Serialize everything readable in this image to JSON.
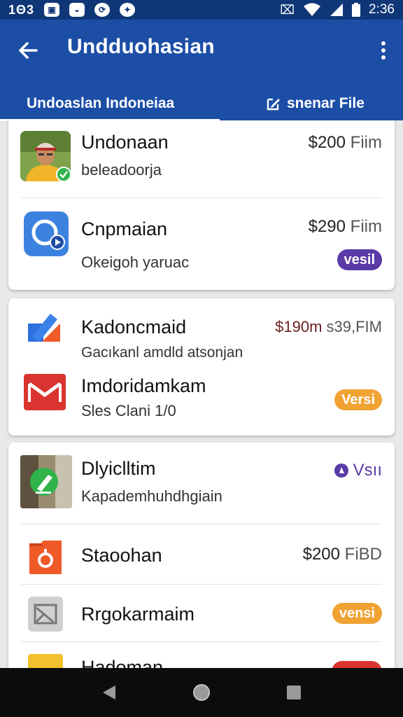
{
  "status_bar": {
    "left_time": "1Θ3",
    "right_time": "2:36",
    "icons": [
      "image-icon",
      "bag-icon",
      "sync-icon",
      "location-icon",
      "vibrate-icon",
      "wifi-icon",
      "signal-icon",
      "battery-icon"
    ]
  },
  "header": {
    "title": "Undduohasian",
    "tabs": [
      {
        "label": "Undoaslan  Indoneiaa"
      },
      {
        "label": "snenar File"
      }
    ]
  },
  "cards": [
    {
      "rows": [
        {
          "title": "Undonaan",
          "subtitle": "beleadoorja",
          "price": "$200",
          "price_suffix": "Fiim",
          "icon": "avatar-photo-icon"
        },
        {
          "title": "Cnpmaian",
          "subtitle": "Okeigoh yaruac",
          "price": "$290",
          "price_suffix": "Fiim",
          "badge": "vesil",
          "icon": "chat-bubble-icon"
        }
      ]
    },
    {
      "rows": [
        {
          "title": "Kadoncmaid",
          "subtitle": "Gacıkanl amdld atsonjan",
          "price": "$190m",
          "price_suffix": "s39,FIM",
          "icon": "edit-square-icon"
        },
        {
          "title": "Imdoridamkam",
          "subtitle": "Sles Clani 1/0",
          "badge": "Versi",
          "icon": "mail-icon"
        }
      ]
    },
    {
      "rows": [
        {
          "title": "Dlyiclltim",
          "subtitle": "Kapademhuhdhgiain",
          "badge": "Vsıı",
          "icon": "photo-pen-icon"
        },
        {
          "title": "Staoohan",
          "price": "$200",
          "price_suffix": "FiBD",
          "icon": "folder-icon"
        },
        {
          "title": "Rrgokarmaim",
          "badge": "vensi",
          "icon": "photo-frame-icon"
        },
        {
          "title": "Hadoman",
          "icon": "notes-icon"
        }
      ]
    }
  ],
  "colors": {
    "status_bar": "#0f3677",
    "app_bar": "#1c4ea6",
    "badge_purple": "#5a3aa6",
    "badge_orange": "#f0a232",
    "badge_red": "#d9342f"
  },
  "nav": {
    "back": "back-icon",
    "home": "home-icon",
    "recents": "recents-icon"
  }
}
